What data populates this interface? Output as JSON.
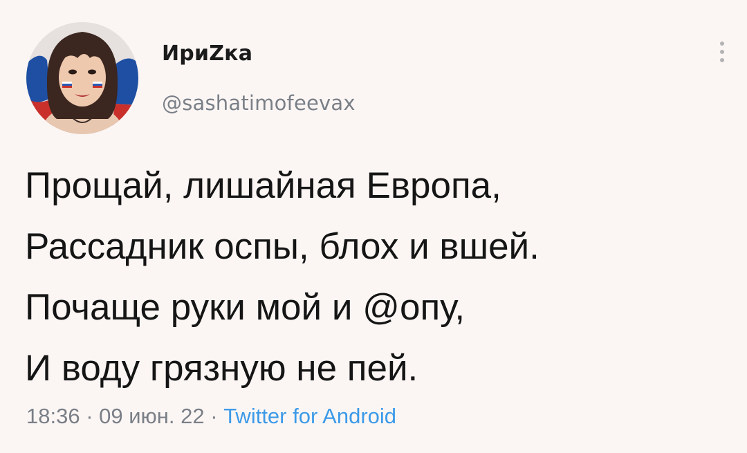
{
  "user": {
    "display_name": "ИриZка",
    "handle": "@sashatimofeevax"
  },
  "tweet": {
    "lines": [
      "Прощай, лишайная Европа,",
      "Рассадник оспы, блох и вшей.",
      "Почаще руки мой и @опу,",
      "И воду грязную не пей."
    ]
  },
  "meta": {
    "time": "18:36",
    "separator": " · ",
    "date": "09 июн. 22",
    "source": "Twitter for Android"
  },
  "icons": {
    "avatar": "profile-photo",
    "more": "more-options-vertical-dots-icon"
  },
  "colors": {
    "background": "#fbf6f4",
    "text": "#151515",
    "muted": "#7a7f87",
    "link": "#3d9ae8"
  }
}
